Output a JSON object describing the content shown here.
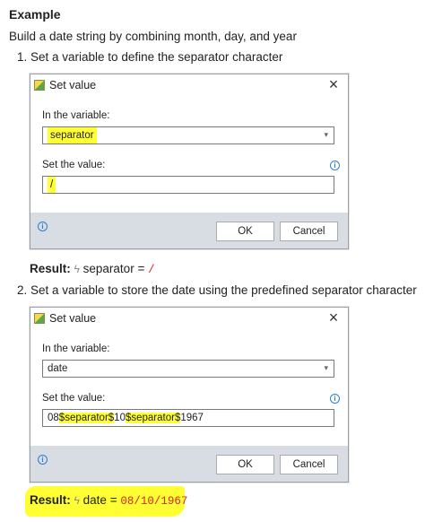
{
  "heading": "Example",
  "intro": "Build a date string by combining month, day, and year",
  "steps": [
    {
      "text": "1. Set a variable to define the separator character",
      "dialog": {
        "title": "Set value",
        "variable_label": "In the variable:",
        "variable_value": "separator",
        "value_label": "Set the value:",
        "value_text": "/",
        "ok_label": "OK",
        "cancel_label": "Cancel"
      },
      "result": {
        "label": "Result:",
        "variable": "separator",
        "equals": "=",
        "value": "/"
      }
    },
    {
      "text": "2. Set a variable to store the date using the predefined separator character",
      "dialog": {
        "title": "Set value",
        "variable_label": "In the variable:",
        "variable_value": "date",
        "value_label": "Set the value:",
        "value_parts": [
          "08",
          "$separator$",
          "10",
          "$separator$",
          "1967"
        ],
        "ok_label": "OK",
        "cancel_label": "Cancel"
      },
      "result": {
        "label": "Result:",
        "variable": "date",
        "equals": "=",
        "value": "08/10/1967"
      }
    }
  ],
  "icons": {
    "close": "×",
    "chevron": "▾",
    "info": "i",
    "bolt": "ϟ"
  },
  "colors": {
    "highlight": "#ffff33",
    "footer": "#d8dde3",
    "result_value": "#d9231f",
    "info": "#2d7fd0"
  }
}
